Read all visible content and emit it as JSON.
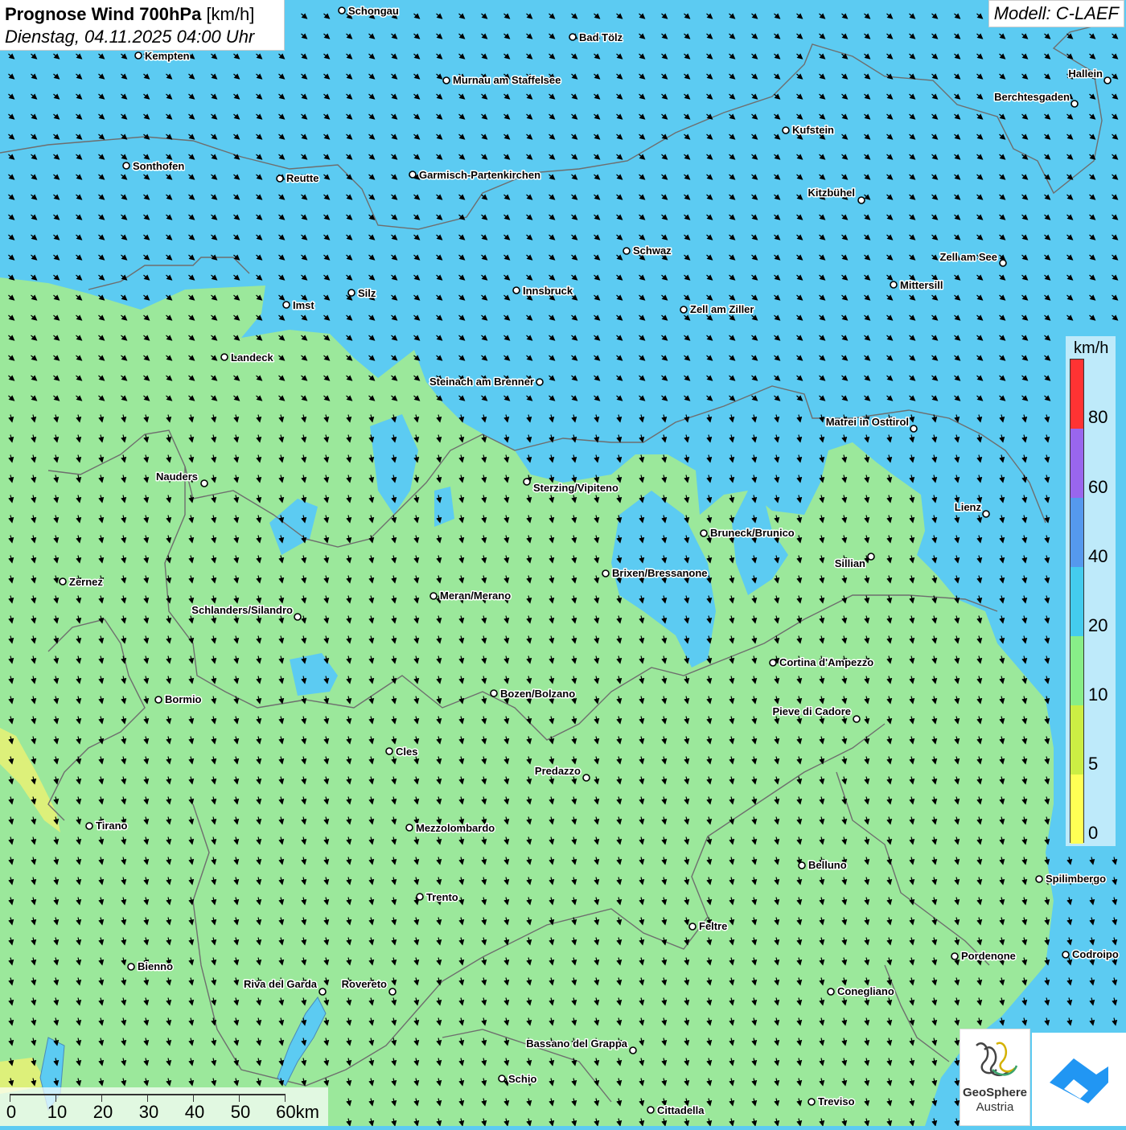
{
  "title": {
    "main": "Prognose Wind 700hPa",
    "unit": "[km/h]",
    "date": "Dienstag, 04.11.2025 04:00 Uhr"
  },
  "model": "Modell: C-LAEF",
  "legend": {
    "unit": "km/h",
    "levels": [
      {
        "label": "80",
        "color": "#ff3333"
      },
      {
        "label": "60",
        "color": "#9966ee"
      },
      {
        "label": "40",
        "color": "#5599ee"
      },
      {
        "label": "20",
        "color": "#44ccee"
      },
      {
        "label": "10",
        "color": "#88ee88"
      },
      {
        "label": "5",
        "color": "#ccee44"
      },
      {
        "label": "0",
        "color": "#ffff55"
      }
    ]
  },
  "scalebar": {
    "labels": [
      "0",
      "10",
      "20",
      "30",
      "40",
      "50",
      "60km"
    ]
  },
  "logos": {
    "geosphere_line1": "GeoSphere",
    "geosphere_line2": "Austria"
  },
  "colors": {
    "wind_20_40": "#5ccbf2",
    "wind_10_20": "#9be89b",
    "wind_5_10": "#ddf07a",
    "border": "#6e6e6e",
    "arrow": "#000000"
  },
  "wind_direction": "northwest",
  "cities": [
    "Schongau",
    "Bad Tölz",
    "Kempten",
    "Murnau am Staffelsee",
    "Hallein",
    "Berchtesgaden",
    "Kufstein",
    "Sonthofen",
    "Reutte",
    "Garmisch-Partenkirchen",
    "Kitzbühel",
    "Schwaz",
    "Zell am See",
    "Innsbruck",
    "Silz",
    "Imst",
    "Mittersill",
    "Zell am Ziller",
    "Landeck",
    "Steinach am Brenner",
    "Matrei in Osttirol",
    "Nauders",
    "Sterzing/Vipiteno",
    "Lienz",
    "Bruneck/Brunico",
    "Sillian",
    "Brixen/Bressanone",
    "Zernez",
    "Meran/Merano",
    "Schlanders/Silandro",
    "Cortina d'Ampezzo",
    "Bozen/Bolzano",
    "Bormio",
    "Pieve di Cadore",
    "Cles",
    "Predazzo",
    "Tirano",
    "Mezzolombardo",
    "Belluno",
    "Spilimbergo",
    "Trento",
    "Feltre",
    "Pordenone",
    "Codroipo",
    "Bienno",
    "Riva del Garda",
    "Rovereto",
    "Conegliano",
    "Bassano del Grappa",
    "Schio",
    "Treviso",
    "Cittadella"
  ]
}
